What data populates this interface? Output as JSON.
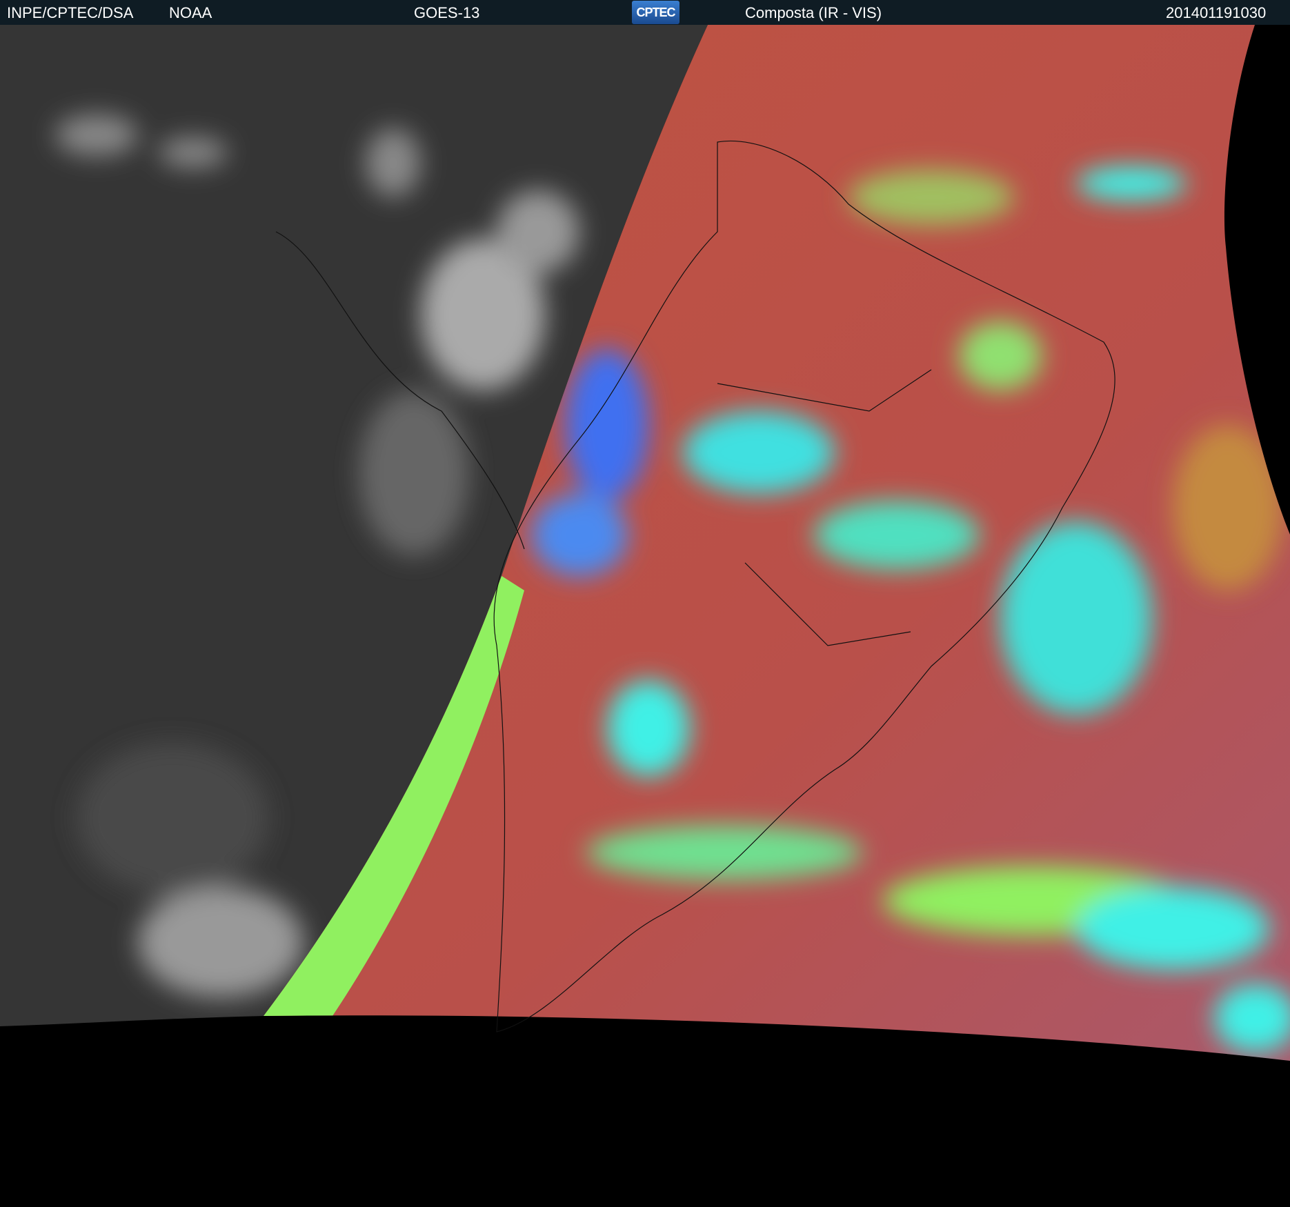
{
  "header": {
    "agency": "INPE/CPTEC/DSA",
    "source": "NOAA",
    "satellite": "GOES-13",
    "logo_text": "CPTEC",
    "product": "Composta (IR - VIS)",
    "timestamp": "201401191030"
  },
  "colors": {
    "header_bg": "#0f1c24",
    "ir_gray": "#3a3a3a",
    "vis_red": "#b9534a",
    "cloud_cyan": "#3ff0e6",
    "cloud_green": "#90f060",
    "cloud_blue": "#4070f0"
  }
}
